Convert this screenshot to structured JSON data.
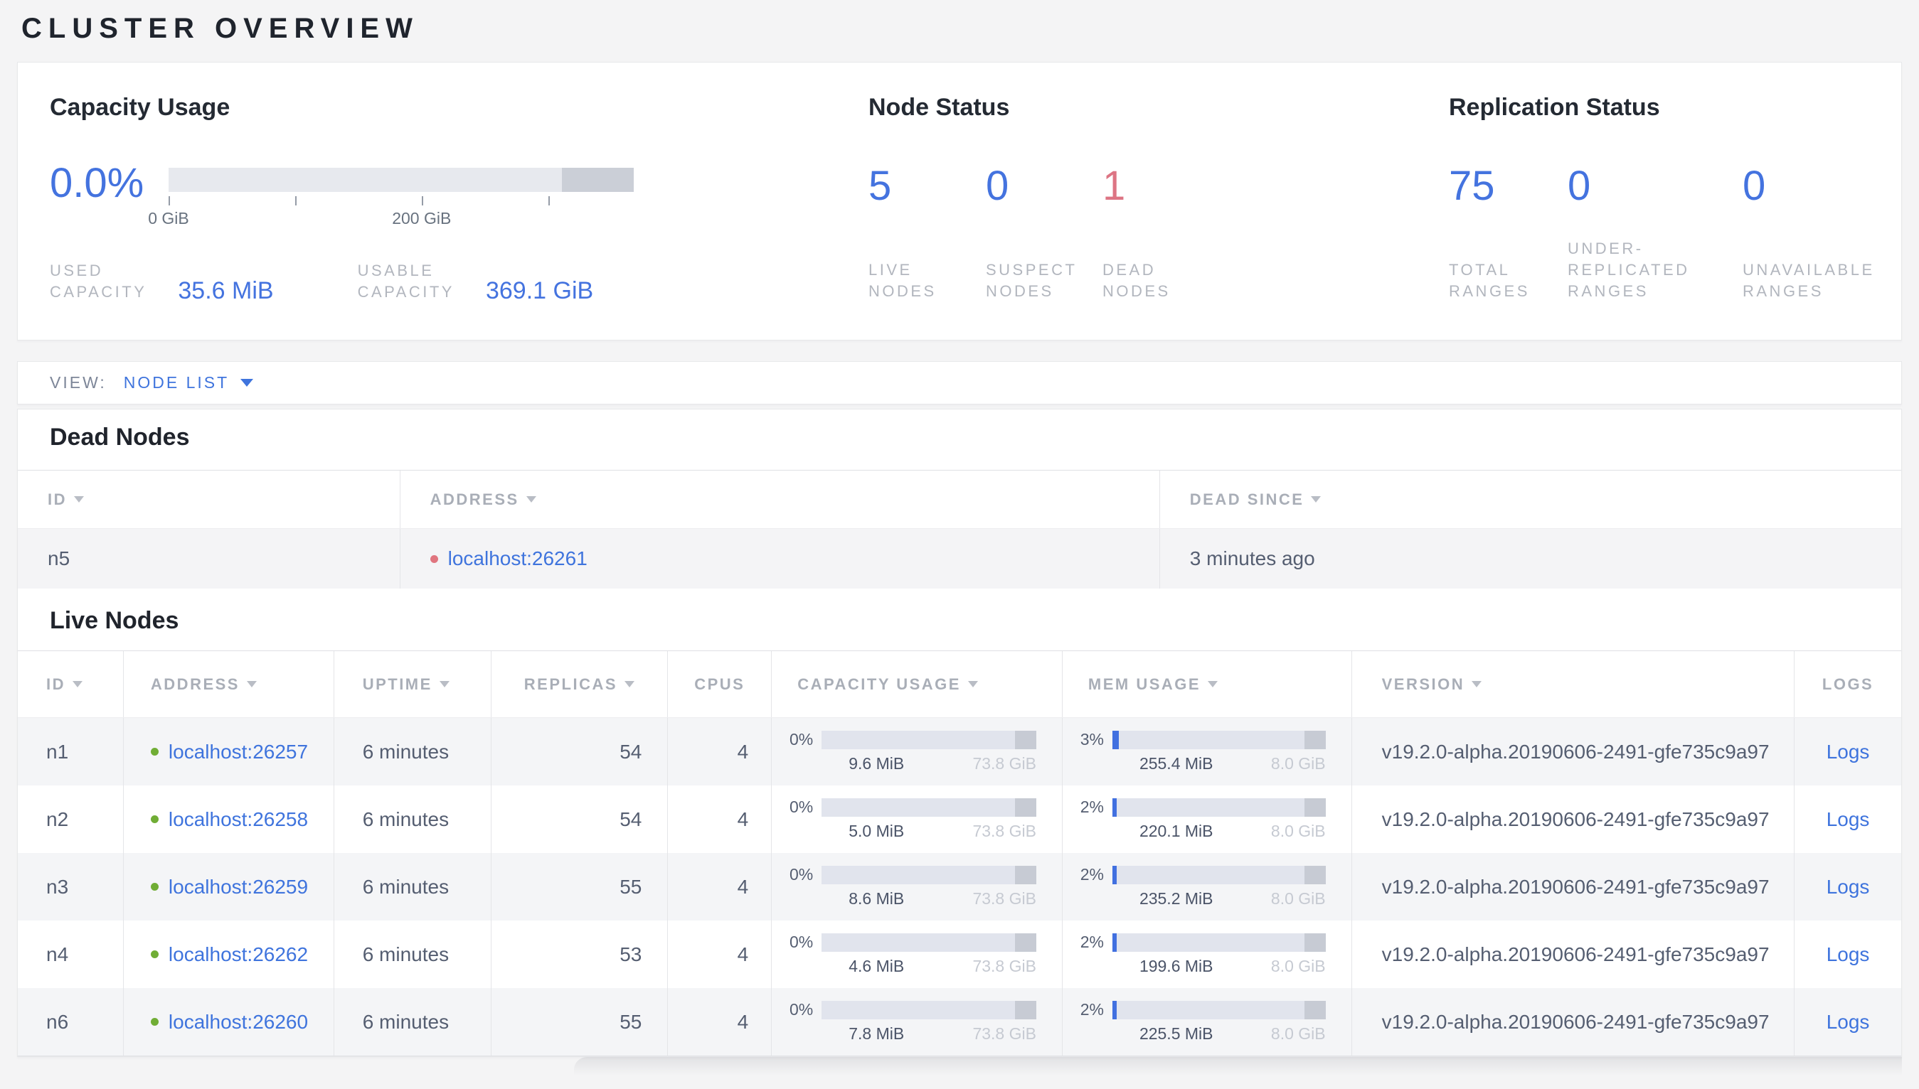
{
  "page": {
    "title": "CLUSTER OVERVIEW"
  },
  "colors": {
    "accent_blue": "#4473df",
    "link_blue": "#3f74dd",
    "dead_red": "#dd7584",
    "live_dot_green": "#70ad35",
    "dead_dot_red": "#e0757f",
    "page_background": "#f4f4f5"
  },
  "summary": {
    "capacity": {
      "title": "Capacity Usage",
      "percent": "0.0%",
      "axis_tick_labels": {
        "first": "0 GiB",
        "third": "200 GiB"
      },
      "used_label": "USED\nCAPACITY",
      "used_value": "35.6 MiB",
      "usable_label": "USABLE\nCAPACITY",
      "usable_value": "369.1 GiB"
    },
    "node_status": {
      "title": "Node Status",
      "live": {
        "value": "5",
        "label": "LIVE\nNODES"
      },
      "suspect": {
        "value": "0",
        "label": "SUSPECT\nNODES"
      },
      "dead": {
        "value": "1",
        "label": "DEAD\nNODES"
      }
    },
    "replication": {
      "title": "Replication Status",
      "total": {
        "value": "75",
        "label": "TOTAL\nRANGES"
      },
      "under": {
        "value": "0",
        "label": "UNDER-\nREPLICATED\nRANGES"
      },
      "unavailable": {
        "value": "0",
        "label": "UNAVAILABLE\nRANGES"
      }
    }
  },
  "view_bar": {
    "label": "VIEW:",
    "selected": "NODE LIST"
  },
  "dead_nodes": {
    "title": "Dead Nodes",
    "columns": {
      "id": "ID",
      "address": "ADDRESS",
      "dead_since": "DEAD SINCE"
    },
    "rows": [
      {
        "id": "n5",
        "address": "localhost:26261",
        "dead_since": "3 minutes ago"
      }
    ]
  },
  "live_nodes": {
    "title": "Live Nodes",
    "columns": {
      "id": "ID",
      "address": "ADDRESS",
      "uptime": "UPTIME",
      "replicas": "REPLICAS",
      "cpus": "CPUS",
      "capacity": "CAPACITY USAGE",
      "mem": "MEM USAGE",
      "version": "VERSION",
      "logs": "LOGS"
    },
    "rows": [
      {
        "id": "n1",
        "address": "localhost:26257",
        "uptime": "6 minutes",
        "replicas": "54",
        "cpus": "4",
        "capacity_percent": "0%",
        "capacity_used": "9.6 MiB",
        "capacity_total": "73.8 GiB",
        "mem_percent": "3%",
        "mem_used": "255.4 MiB",
        "mem_total": "8.0 GiB",
        "version": "v19.2.0-alpha.20190606-2491-gfe735c9a97",
        "logs": "Logs"
      },
      {
        "id": "n2",
        "address": "localhost:26258",
        "uptime": "6 minutes",
        "replicas": "54",
        "cpus": "4",
        "capacity_percent": "0%",
        "capacity_used": "5.0 MiB",
        "capacity_total": "73.8 GiB",
        "mem_percent": "2%",
        "mem_used": "220.1 MiB",
        "mem_total": "8.0 GiB",
        "version": "v19.2.0-alpha.20190606-2491-gfe735c9a97",
        "logs": "Logs"
      },
      {
        "id": "n3",
        "address": "localhost:26259",
        "uptime": "6 minutes",
        "replicas": "55",
        "cpus": "4",
        "capacity_percent": "0%",
        "capacity_used": "8.6 MiB",
        "capacity_total": "73.8 GiB",
        "mem_percent": "2%",
        "mem_used": "235.2 MiB",
        "mem_total": "8.0 GiB",
        "version": "v19.2.0-alpha.20190606-2491-gfe735c9a97",
        "logs": "Logs"
      },
      {
        "id": "n4",
        "address": "localhost:26262",
        "uptime": "6 minutes",
        "replicas": "53",
        "cpus": "4",
        "capacity_percent": "0%",
        "capacity_used": "4.6 MiB",
        "capacity_total": "73.8 GiB",
        "mem_percent": "2%",
        "mem_used": "199.6 MiB",
        "mem_total": "8.0 GiB",
        "version": "v19.2.0-alpha.20190606-2491-gfe735c9a97",
        "logs": "Logs"
      },
      {
        "id": "n6",
        "address": "localhost:26260",
        "uptime": "6 minutes",
        "replicas": "55",
        "cpus": "4",
        "capacity_percent": "0%",
        "capacity_used": "7.8 MiB",
        "capacity_total": "73.8 GiB",
        "mem_percent": "2%",
        "mem_used": "225.5 MiB",
        "mem_total": "8.0 GiB",
        "version": "v19.2.0-alpha.20190606-2491-gfe735c9a97",
        "logs": "Logs"
      }
    ]
  }
}
